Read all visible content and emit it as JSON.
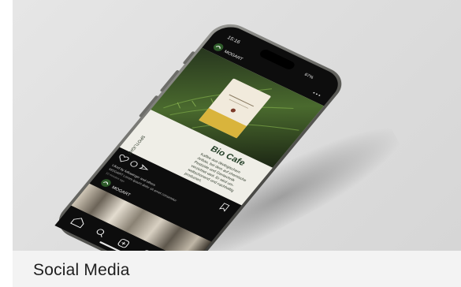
{
  "caption": "Social Media",
  "phone": {
    "status_time": "15:16",
    "status_battery": "67%",
    "post": {
      "account_name": "MOGART",
      "headline": "Bio Cafe",
      "body_lines": [
        "Kaffee aus ökologischem",
        "Anbau, bei dem auf chemische",
        "Pestizide und Gentechnik",
        "verzichtet wird. Er wird um-",
        "weltschonend und nachhaltig",
        "produziert."
      ],
      "side_label": "SPOTLIGHT",
      "likes_text": "Liked by followinger and others",
      "caption_text": "MOGART Lorem ipsum dolor sit amet consetetur",
      "time_ago": "10 minutes ago"
    },
    "next_post": {
      "account_name": "MOGART"
    }
  }
}
